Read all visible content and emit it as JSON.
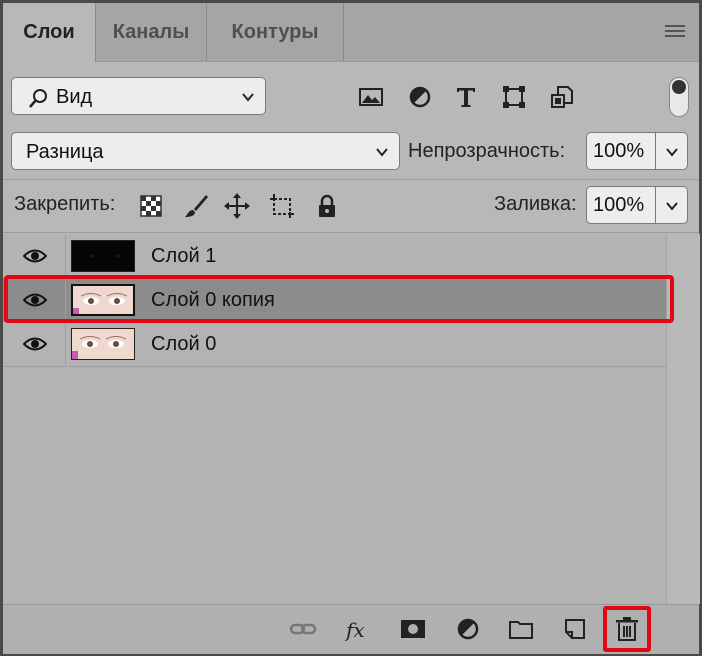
{
  "tabs": [
    {
      "label": "Слои",
      "active": true
    },
    {
      "label": "Каналы",
      "active": false
    },
    {
      "label": "Контуры",
      "active": false
    }
  ],
  "filter": {
    "label": "Вид",
    "icon": "search-icon"
  },
  "filter_icons": [
    "image-icon",
    "adjustment-icon",
    "type-icon",
    "shape-icon",
    "smart-object-icon"
  ],
  "blend": {
    "value": "Разница"
  },
  "opacity": {
    "label": "Непрозрачность:",
    "value": "100%"
  },
  "lock": {
    "label": "Закрепить:",
    "icons": [
      "lock-transparency-icon",
      "lock-pixels-icon",
      "lock-position-icon",
      "lock-artboard-icon",
      "lock-all-icon"
    ]
  },
  "fill": {
    "label": "Заливка:",
    "value": "100%"
  },
  "layers": [
    {
      "name": "Слой 1",
      "visible": true,
      "selected": false,
      "thumb": "dark"
    },
    {
      "name": "Слой 0 копия",
      "visible": true,
      "selected": true,
      "thumb": "eyes"
    },
    {
      "name": "Слой 0",
      "visible": true,
      "selected": false,
      "thumb": "eyes"
    }
  ],
  "bottom_icons": [
    "link-icon",
    "fx-icon",
    "mask-icon",
    "adjustment-layer-icon",
    "folder-icon",
    "new-layer-icon",
    "trash-icon"
  ],
  "colors": {
    "highlight": "#e30613",
    "panel": "#b8b8b8",
    "selected_row": "#8c8c8c"
  }
}
